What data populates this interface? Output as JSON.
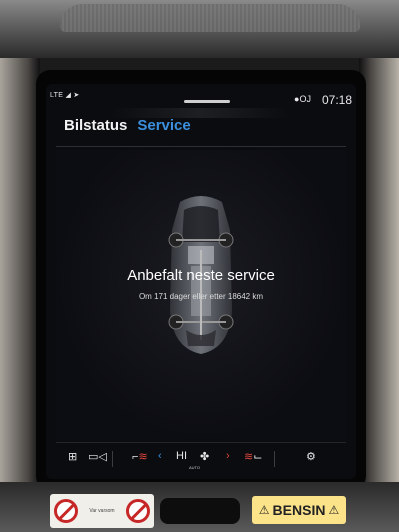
{
  "statusbar": {
    "network": "LTE",
    "user": "OJ",
    "time": "07:18"
  },
  "tabs": [
    {
      "label": "Bilstatus",
      "active": false
    },
    {
      "label": "Service",
      "active": true
    }
  ],
  "service": {
    "title": "Anbefalt neste service",
    "subtitle": "Om 171 dager eller etter 18642 km"
  },
  "climate_bar": {
    "fan_label": "HI",
    "auto_label": "AUTO"
  },
  "stickers": {
    "warning_text": "Var varsom",
    "fuel_label": "BENSIN"
  },
  "colors": {
    "accent": "#3b8fdc",
    "heat": "#e0473c",
    "screen_bg": "#0b0c10"
  }
}
